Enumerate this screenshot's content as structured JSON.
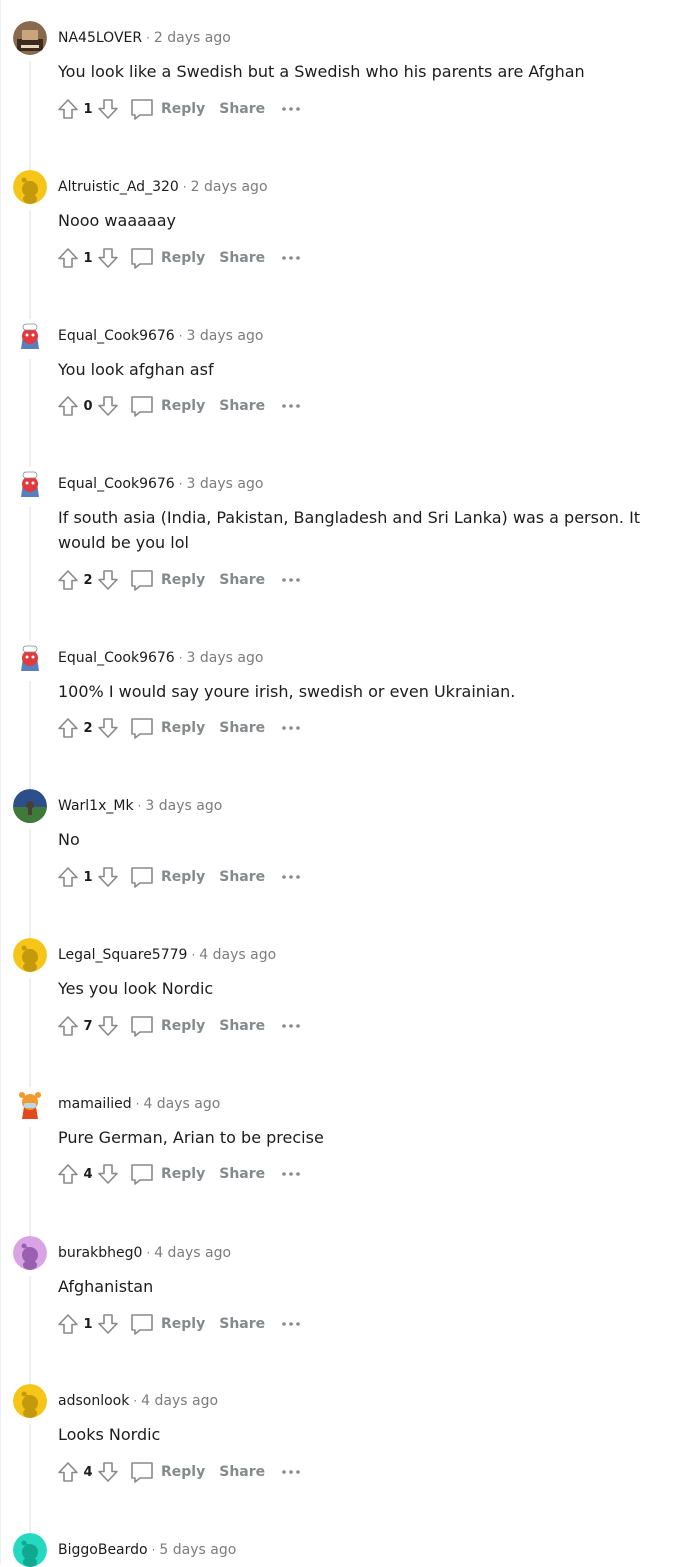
{
  "actions": {
    "reply_label": "Reply",
    "share_label": "Share",
    "more_label": "More options"
  },
  "comments": [
    {
      "username": "NA45LOVER",
      "time": "2 days ago",
      "text": "You look like a Swedish but a Swedish who his parents are Afghan",
      "score": "1",
      "avatar": "photo-bag-avatar"
    },
    {
      "username": "Altruistic_Ad_320",
      "time": "2 days ago",
      "text": "Nooo waaaaay",
      "score": "1",
      "avatar": "yellow-snoo-avatar"
    },
    {
      "username": "Equal_Cook9676",
      "time": "3 days ago",
      "text": "You look afghan asf",
      "score": "0",
      "avatar": "red-chef-snoo-avatar"
    },
    {
      "username": "Equal_Cook9676",
      "time": "3 days ago",
      "text": "If south asia (India, Pakistan, Bangladesh and Sri Lanka) was a person. It would be you lol",
      "score": "2",
      "avatar": "red-chef-snoo-avatar"
    },
    {
      "username": "Equal_Cook9676",
      "time": "3 days ago",
      "text": "100% I would say youre irish, swedish or even Ukrainian.",
      "score": "2",
      "avatar": "red-chef-snoo-avatar"
    },
    {
      "username": "Warl1x_Mk",
      "time": "3 days ago",
      "text": "No",
      "score": "1",
      "avatar": "landscape-photo-avatar"
    },
    {
      "username": "Legal_Square5779",
      "time": "4 days ago",
      "text": "Yes you look Nordic",
      "score": "7",
      "avatar": "yellow-snoo-avatar"
    },
    {
      "username": "mamailied",
      "time": "4 days ago",
      "text": "Pure German, Arian to be precise",
      "score": "4",
      "avatar": "tiger-snoo-avatar"
    },
    {
      "username": "burakbheg0",
      "time": "4 days ago",
      "text": "Afghanistan",
      "score": "1",
      "avatar": "purple-snoo-avatar"
    },
    {
      "username": "adsonlook",
      "time": "4 days ago",
      "text": "Looks Nordic",
      "score": "4",
      "avatar": "yellow-snoo-avatar"
    },
    {
      "username": "BiggoBeardo",
      "time": "5 days ago",
      "text": "",
      "score": "",
      "avatar": "teal-snoo-avatar"
    }
  ],
  "colors": {
    "meta_gray": "#7c7c7c",
    "action_gray": "#878a8c",
    "thread_line": "#edeff1",
    "yellow_avatar": "#f5c518",
    "purple_avatar": "#d9a3e6",
    "teal_avatar": "#24d9c0",
    "red_snoo": "#e0393e"
  }
}
